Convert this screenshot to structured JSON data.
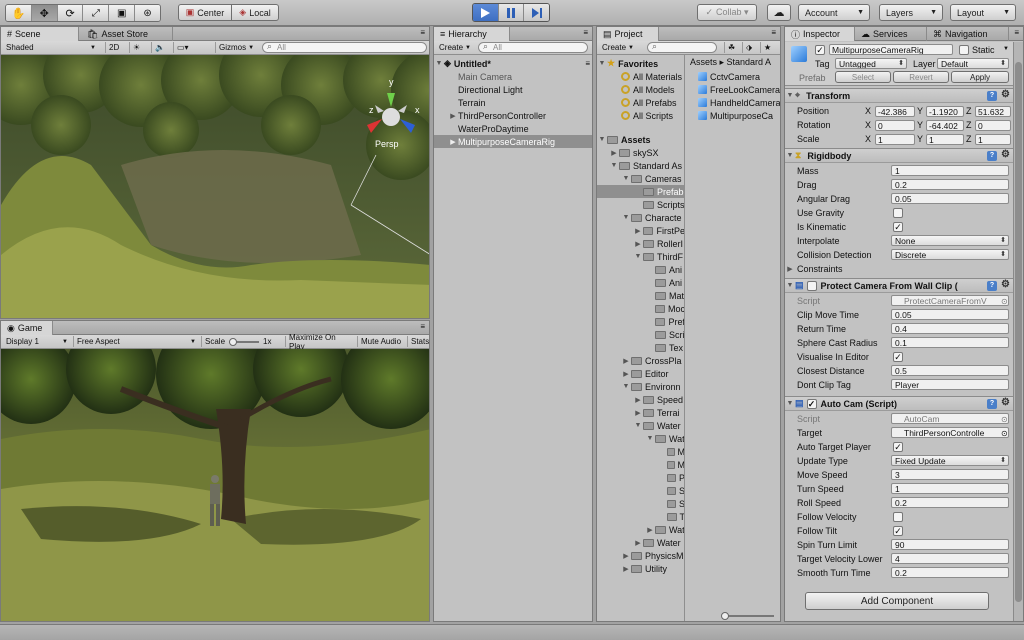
{
  "toolbar": {
    "tools": [
      "hand-icon",
      "move-icon",
      "rotate-icon",
      "scale-icon",
      "rect-icon",
      "transform-icon"
    ],
    "pivot_label": "Center",
    "space_label": "Local",
    "collab_label": "Collab ▾",
    "account_label": "Account",
    "layers_label": "Layers",
    "layout_label": "Layout"
  },
  "scene": {
    "tab_scene": "Scene",
    "tab_asset_store": "Asset Store",
    "shading": "Shaded",
    "mode_2d": "2D",
    "gizmos": "Gizmos",
    "search_placeholder": "All",
    "persp_label": "Persp",
    "gizmo_axes": {
      "y": "y",
      "x": "x",
      "z": "z"
    }
  },
  "game": {
    "tab_label": "Game",
    "display": "Display 1",
    "aspect": "Free Aspect",
    "scale_label": "Scale",
    "scale_value": "1x",
    "maximize_label": "Maximize On Play",
    "mute_label": "Mute Audio",
    "stats_label": "Stats"
  },
  "hierarchy": {
    "tab_label": "Hierarchy",
    "create_label": "Create",
    "search_placeholder": "All",
    "scene_name": "Untitled*",
    "items": [
      "Main Camera",
      "Directional Light",
      "Terrain",
      "ThirdPersonController",
      "WaterProDaytime",
      "MultipurposeCameraRig"
    ]
  },
  "project": {
    "tab_label": "Project",
    "create_label": "Create",
    "favorites_label": "Favorites",
    "favorites": [
      "All Materials",
      "All Models",
      "All Prefabs",
      "All Scripts"
    ],
    "assets_label": "Assets",
    "tree": [
      "skySX",
      "Standard As",
      "Cameras",
      "Prefab",
      "Scripts",
      "Characte",
      "FirstPe",
      "RollerI",
      "ThirdF",
      "Ani",
      "Ani",
      "Mat",
      "Moc",
      "Pref",
      "Scri",
      "Tex",
      "CrossPla",
      "Editor",
      "Environn",
      "Speed",
      "Terrai",
      "Water",
      "Wat",
      "M",
      "M",
      "P",
      "S",
      "S",
      "T",
      "Wat",
      "Water",
      "PhysicsM",
      "Utility"
    ],
    "breadcrumb": "Assets ▸ Standard A",
    "files": [
      "CctvCamera",
      "FreeLookCamera",
      "HandheldCamera",
      "MultipurposeCa"
    ]
  },
  "inspector": {
    "tab_inspector": "Inspector",
    "tab_services": "Services",
    "tab_navigation": "Navigation",
    "object_name": "MultipurposeCameraRig",
    "static_label": "Static",
    "tag_label": "Tag",
    "tag_value": "Untagged",
    "layer_label": "Layer",
    "layer_value": "Default",
    "prefab_label": "Prefab",
    "select_label": "Select",
    "revert_label": "Revert",
    "apply_label": "Apply",
    "transform": {
      "title": "Transform",
      "position_label": "Position",
      "position": [
        "-42.386",
        "-1.1920",
        "51.632"
      ],
      "rotation_label": "Rotation",
      "rotation": [
        "0",
        "-64.402",
        "0"
      ],
      "scale_label": "Scale",
      "scale": [
        "1",
        "1",
        "1"
      ]
    },
    "rigidbody": {
      "title": "Rigidbody",
      "mass_label": "Mass",
      "mass": "1",
      "drag_label": "Drag",
      "drag": "0.2",
      "angular_drag_label": "Angular Drag",
      "angular_drag": "0.05",
      "use_gravity_label": "Use Gravity",
      "is_kinematic_label": "Is Kinematic",
      "interpolate_label": "Interpolate",
      "interpolate": "None",
      "collision_label": "Collision Detection",
      "collision": "Discrete",
      "constraints_label": "Constraints"
    },
    "protect": {
      "title": "Protect Camera From Wall Clip (",
      "script_label": "Script",
      "script": "ProtectCameraFromV",
      "clip_move_label": "Clip Move Time",
      "clip_move": "0.05",
      "return_label": "Return Time",
      "return_time": "0.4",
      "sphere_label": "Sphere Cast Radius",
      "sphere": "0.1",
      "visualise_label": "Visualise In Editor",
      "closest_label": "Closest Distance",
      "closest": "0.5",
      "dont_clip_label": "Dont Clip Tag",
      "dont_clip": "Player"
    },
    "autocam": {
      "title": "Auto Cam (Script)",
      "script_label": "Script",
      "script": "AutoCam",
      "target_label": "Target",
      "target": "ThirdPersonControlle",
      "auto_target_label": "Auto Target Player",
      "update_type_label": "Update Type",
      "update_type": "Fixed Update",
      "move_speed_label": "Move Speed",
      "move_speed": "3",
      "turn_speed_label": "Turn Speed",
      "turn_speed": "1",
      "roll_speed_label": "Roll Speed",
      "roll_speed": "0.2",
      "follow_velocity_label": "Follow Velocity",
      "follow_tilt_label": "Follow Tilt",
      "spin_label": "Spin Turn Limit",
      "spin": "90",
      "target_vel_label": "Target Velocity Lower",
      "target_vel": "4",
      "smooth_label": "Smooth Turn Time",
      "smooth": "0.2"
    },
    "add_component_label": "Add Component"
  }
}
